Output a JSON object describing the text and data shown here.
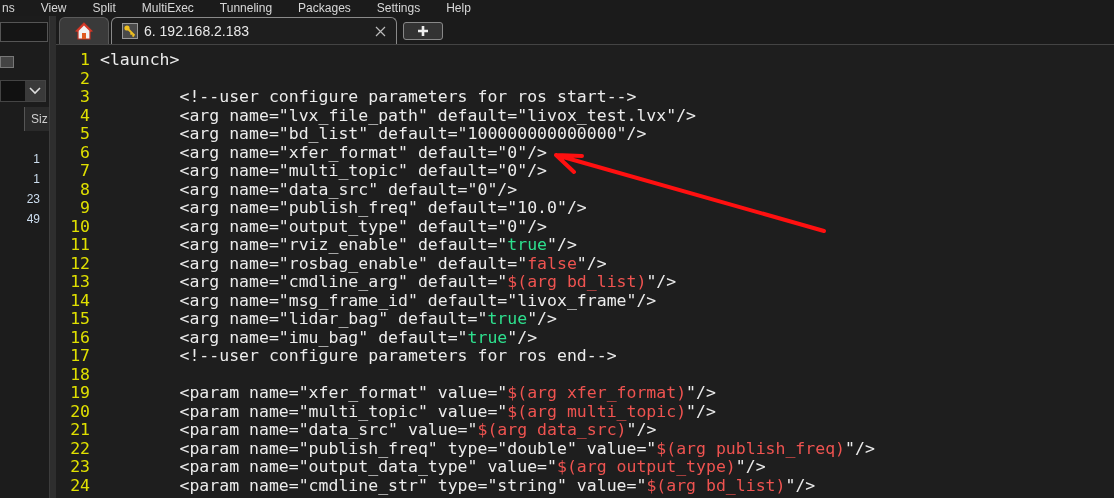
{
  "menu": [
    "ns",
    "View",
    "Split",
    "MultiExec",
    "Tunneling",
    "Packages",
    "Settings",
    "Help"
  ],
  "sidebar": {
    "column_header": "Siz",
    "sizes": [
      "1",
      "1",
      "23",
      "49"
    ]
  },
  "tabs": [
    {
      "kind": "home",
      "selected": false
    },
    {
      "kind": "session",
      "label": "6. 192.168.2.183",
      "selected": true
    }
  ],
  "editor": {
    "lines": [
      {
        "number": "1",
        "segments": [
          {
            "kind": "plain",
            "text": "<launch>"
          }
        ]
      },
      {
        "number": "2"
      },
      {
        "number": "3",
        "segments": [
          {
            "kind": "plain",
            "text": "        <!--user configure parameters for ros start-->"
          }
        ]
      },
      {
        "number": "4",
        "segments": [
          {
            "kind": "plain",
            "text": "        <arg name=\"lvx_file_path\" default=\"livox_test.lvx\"/>"
          }
        ]
      },
      {
        "number": "5",
        "segments": [
          {
            "kind": "plain",
            "text": "        <arg name=\"bd_list\" default=\"100000000000000\"/>"
          }
        ]
      },
      {
        "number": "6",
        "segments": [
          {
            "kind": "plain",
            "text": "        <arg name=\"xfer_format\" default=\"0\"/>"
          }
        ]
      },
      {
        "number": "7",
        "segments": [
          {
            "kind": "plain",
            "text": "        <arg name=\"multi_topic\" default=\"0\"/>"
          }
        ]
      },
      {
        "number": "8",
        "segments": [
          {
            "kind": "plain",
            "text": "        <arg name=\"data_src\" default=\"0\"/>"
          }
        ]
      },
      {
        "number": "9",
        "segments": [
          {
            "kind": "plain",
            "text": "        <arg name=\"publish_freq\" default=\"10.0\"/>"
          }
        ]
      },
      {
        "number": "10",
        "segments": [
          {
            "kind": "plain",
            "text": "        <arg name=\"output_type\" default=\"0\"/>"
          }
        ]
      },
      {
        "number": "11",
        "segments": [
          {
            "kind": "plain",
            "text": "        <arg name=\"rviz_enable\" default=\""
          },
          {
            "kind": "true",
            "text": "true"
          },
          {
            "kind": "plain",
            "text": "\"/>"
          }
        ]
      },
      {
        "number": "12",
        "segments": [
          {
            "kind": "plain",
            "text": "        <arg name=\"rosbag_enable\" default=\""
          },
          {
            "kind": "false",
            "text": "false"
          },
          {
            "kind": "plain",
            "text": "\"/>"
          }
        ]
      },
      {
        "number": "13",
        "segments": [
          {
            "kind": "plain",
            "text": "        <arg name=\"cmdline_arg\" default=\""
          },
          {
            "kind": "substitution",
            "text": "$(arg bd_list)"
          },
          {
            "kind": "plain",
            "text": "\"/>"
          }
        ]
      },
      {
        "number": "14",
        "segments": [
          {
            "kind": "plain",
            "text": "        <arg name=\"msg_frame_id\" default=\"livox_frame\"/>"
          }
        ]
      },
      {
        "number": "15",
        "segments": [
          {
            "kind": "plain",
            "text": "        <arg name=\"lidar_bag\" default=\""
          },
          {
            "kind": "true",
            "text": "true"
          },
          {
            "kind": "plain",
            "text": "\"/>"
          }
        ]
      },
      {
        "number": "16",
        "segments": [
          {
            "kind": "plain",
            "text": "        <arg name=\"imu_bag\" default=\""
          },
          {
            "kind": "true",
            "text": "true"
          },
          {
            "kind": "plain",
            "text": "\"/>"
          }
        ]
      },
      {
        "number": "17",
        "segments": [
          {
            "kind": "plain",
            "text": "        <!--user configure parameters for ros end-->"
          }
        ]
      },
      {
        "number": "18"
      },
      {
        "number": "19",
        "segments": [
          {
            "kind": "plain",
            "text": "        <param name=\"xfer_format\" value=\""
          },
          {
            "kind": "substitution",
            "text": "$(arg xfer_format)"
          },
          {
            "kind": "plain",
            "text": "\"/>"
          }
        ]
      },
      {
        "number": "20",
        "segments": [
          {
            "kind": "plain",
            "text": "        <param name=\"multi_topic\" value=\""
          },
          {
            "kind": "substitution",
            "text": "$(arg multi_topic)"
          },
          {
            "kind": "plain",
            "text": "\"/>"
          }
        ]
      },
      {
        "number": "21",
        "segments": [
          {
            "kind": "plain",
            "text": "        <param name=\"data_src\" value=\""
          },
          {
            "kind": "substitution",
            "text": "$(arg data_src)"
          },
          {
            "kind": "plain",
            "text": "\"/>"
          }
        ]
      },
      {
        "number": "22",
        "segments": [
          {
            "kind": "plain",
            "text": "        <param name=\"publish_freq\" type=\"double\" value=\""
          },
          {
            "kind": "substitution",
            "text": "$(arg publish_freq)"
          },
          {
            "kind": "plain",
            "text": "\"/>"
          }
        ]
      },
      {
        "number": "23",
        "segments": [
          {
            "kind": "plain",
            "text": "        <param name=\"output_data_type\" value=\""
          },
          {
            "kind": "substitution",
            "text": "$(arg output_type)"
          },
          {
            "kind": "plain",
            "text": "\"/>"
          }
        ]
      },
      {
        "number": "24",
        "segments": [
          {
            "kind": "plain",
            "text": "        <param name=\"cmdline_str\" type=\"string\" value=\""
          },
          {
            "kind": "substitution",
            "text": "$(arg bd_list)"
          },
          {
            "kind": "plain",
            "text": "\"/>"
          }
        ]
      }
    ]
  }
}
